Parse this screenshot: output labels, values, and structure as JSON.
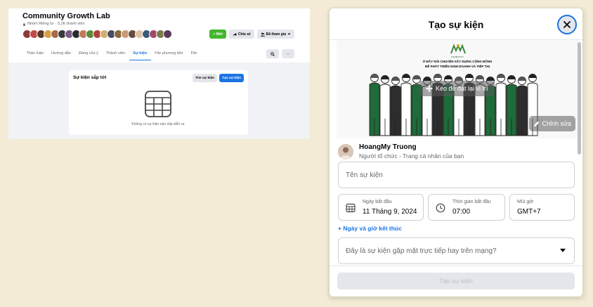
{
  "group": {
    "name": "Community Growth Lab",
    "privacy": "Nhóm Riêng tư",
    "separator": "·",
    "member_count": "5,2K thành viên",
    "actions": {
      "invite": "+ Mời",
      "share": "Chia sẻ",
      "joined": "Đã tham gia"
    },
    "tabs": [
      "Thảo luận",
      "Hướng dẫn",
      "Đáng chú ý",
      "Thành viên",
      "Sự kiện",
      "File phương tiện",
      "File"
    ],
    "active_tab": "Sự kiện",
    "tools": {
      "search": "⌕",
      "more": "···"
    },
    "events": {
      "title": "Sự kiện sắp tới",
      "find_button": "Tìm sự kiện",
      "create_button": "Tạo sự kiện",
      "empty_text": "Không có sự kiện nào sắp diễn ra."
    },
    "member_colors": [
      "#8b3a3a",
      "#c24a4a",
      "#5a3a2a",
      "#d4a040",
      "#a86a4a",
      "#3a3a3a",
      "#7a5a8a",
      "#2a2a2a",
      "#c07a5a",
      "#5a8a3a",
      "#b04040",
      "#d0b070",
      "#4a4a6a",
      "#8a6a3a",
      "#c89a7a",
      "#6a4a3a",
      "#e0c0a0",
      "#3a5a7a",
      "#a04a6a",
      "#7a7a4a",
      "#5a3a5a"
    ]
  },
  "modal": {
    "title": "Tạo sự kiện",
    "close_icon": "close-icon",
    "cover": {
      "logo_text": "COMMUNITY",
      "line1": "Ở ĐÂY NÓI CHUYỆN XÂY DỰNG CỘNG ĐỒNG",
      "line2": "ĐỂ PHÁT TRIỂN KINH DOANH VÀ TIẾP THỊ",
      "reposition_label": "Kéo để đặt lại vị trí",
      "edit_label": "Chỉnh sửa"
    },
    "organizer": {
      "name": "HoangMy Truong",
      "role": "Người tổ chức - Trang cá nhân của bạn"
    },
    "event_name_placeholder": "Tên sự kiện",
    "start_date": {
      "label": "Ngày bắt đầu",
      "value": "11 Tháng 9, 2024"
    },
    "start_time": {
      "label": "Thời gian bắt đầu",
      "value": "07:00"
    },
    "timezone": {
      "label": "Múi giờ",
      "value": "GMT+7"
    },
    "end_link": "+ Ngày và giờ kết thúc",
    "location_placeholder": "Đây là sự kiện gặp mặt trực tiếp hay trên mạng?",
    "submit_label": "Tạo sự kiện"
  },
  "colors": {
    "background": "#f3ebd5",
    "accent_blue": "#1b74e4",
    "green": "#42b72a",
    "illustration_green": "#1f6b3a"
  }
}
